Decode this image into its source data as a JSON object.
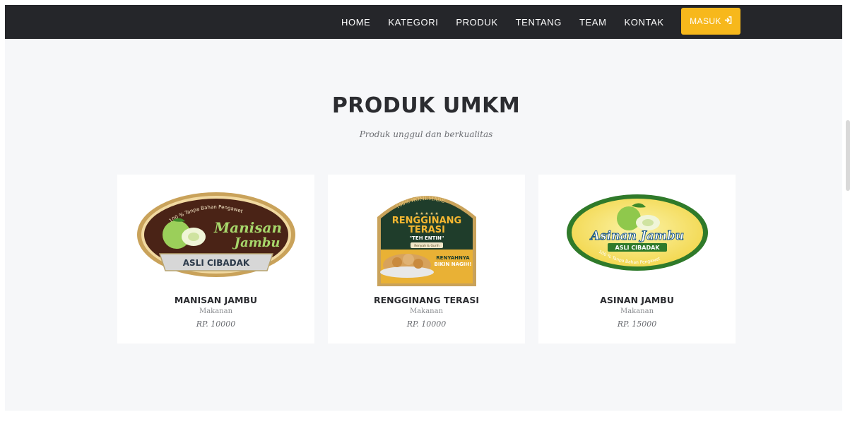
{
  "nav": {
    "links": [
      "HOME",
      "KATEGORI",
      "PRODUK",
      "TENTANG",
      "TEAM",
      "KONTAK"
    ],
    "login_label": "MASUK",
    "login_icon": "sign-in-icon"
  },
  "section": {
    "title": "PRODUK UMKM",
    "subtitle": "Produk unggul dan berkualitas"
  },
  "products": [
    {
      "name": "MANISAN JAMBU",
      "category": "Makanan",
      "price": "RP. 10000",
      "label": {
        "top_arc": "100 % Tanpa Bahan Pengawet",
        "brand_line1": "Manisan",
        "brand_line2": "Jambu",
        "banner": "ASLI CIBADAK"
      }
    },
    {
      "name": "RENGGINANG TERASI",
      "category": "Makanan",
      "price": "RP. 10000",
      "label": {
        "top_arc": "100% HOMEMADE",
        "brand_line1": "RENGGINANG",
        "brand_line2": "TERASI",
        "maker": "\"TEH ENTIN\"",
        "tag": "Renyah & Gurih",
        "slogan1": "RENYAHNYA",
        "slogan2": "BIKIN NAGIH!"
      }
    },
    {
      "name": "ASINAN JAMBU",
      "category": "Makanan",
      "price": "RP. 15000",
      "label": {
        "brand": "Asinan Jambu",
        "banner": "ASLI CIBADAK",
        "bottom_arc": "100 % Tanpa Bahan Pengawet"
      }
    }
  ],
  "colors": {
    "navbar": "#25262a",
    "accent": "#f7b81c",
    "section_bg": "#f6f7f9"
  }
}
